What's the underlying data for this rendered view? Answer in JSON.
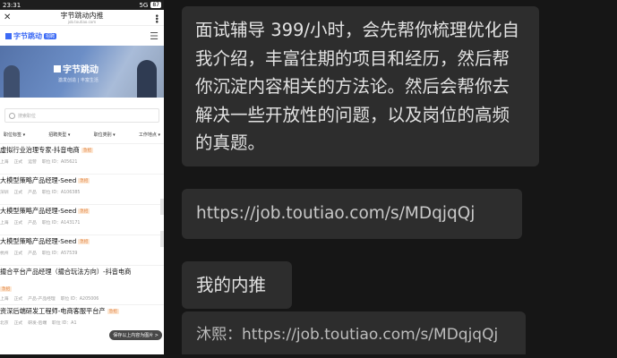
{
  "phone": {
    "status": {
      "time": "23:31",
      "signal": "5G",
      "battery": "87"
    },
    "nav": {
      "close_icon": "close-icon",
      "title": "字节跳动内推",
      "subtitle": "job.toutiao.com",
      "more_icon": "more-icon"
    },
    "brand": {
      "name": "字节跳动",
      "badge": "招聘",
      "menu_icon": "hamburger-icon"
    },
    "banner": {
      "logo_text": "字节跳动",
      "sub_left": "激发创造",
      "sub_right": "丰富生活"
    },
    "search": {
      "placeholder": "搜索职位"
    },
    "filters": [
      "职位标签 ▾",
      "招聘类型 ▾",
      "职位类别 ▾",
      "工作地点 ▾"
    ],
    "jobs": [
      {
        "title": "虚拟行业治理专家-抖音电商",
        "tag": "急招",
        "city": "上海",
        "type": "正式",
        "category": "运营",
        "id": "职位 ID：A05621"
      },
      {
        "title": "大模型策略产品经理-Seed",
        "tag": "急招",
        "city": "深圳",
        "type": "正式",
        "category": "产品",
        "id": "职位 ID：A106385"
      },
      {
        "title": "大模型策略产品经理-Seed",
        "tag": "急招",
        "city": "上海",
        "type": "正式",
        "category": "产品",
        "id": "职位 ID：A143171"
      },
      {
        "title": "大模型策略产品经理-Seed",
        "tag": "急招",
        "city": "杭州",
        "type": "正式",
        "category": "产品",
        "id": "职位 ID：A57539"
      },
      {
        "title": "撮合平台产品经理（撮合玩法方向）-抖音电商",
        "tag": "急招",
        "city": "上海",
        "type": "正式",
        "category": "产品-产品经理",
        "id": "职位 ID：A205006"
      },
      {
        "title": "资深后端研发工程师-电商客服平台产",
        "tag": "急招",
        "city": "北京",
        "type": "正式",
        "category": "研发-后端",
        "id": "职位 ID：A1"
      }
    ],
    "save_hint": "保存以上内容为图片 >"
  },
  "chat": {
    "messages": [
      "面试辅导 399/小时，会先帮你梳理优化自我介绍，丰富往期的项目和经历，然后帮你沉淀内容相关的方法论。然后会帮你去解决一些开放性的问题，以及岗位的高频的真题。",
      "https://job.toutiao.com/s/MDqjqQj",
      "我的内推",
      "沐熙：https://job.toutiao.com/s/MDqjqQj"
    ]
  },
  "colors": {
    "background": "#161616",
    "bubble": "#2d2d2d",
    "bubble_text": "#e2e2e2",
    "brand": "#3c6af5",
    "tag": "#e0813f"
  }
}
